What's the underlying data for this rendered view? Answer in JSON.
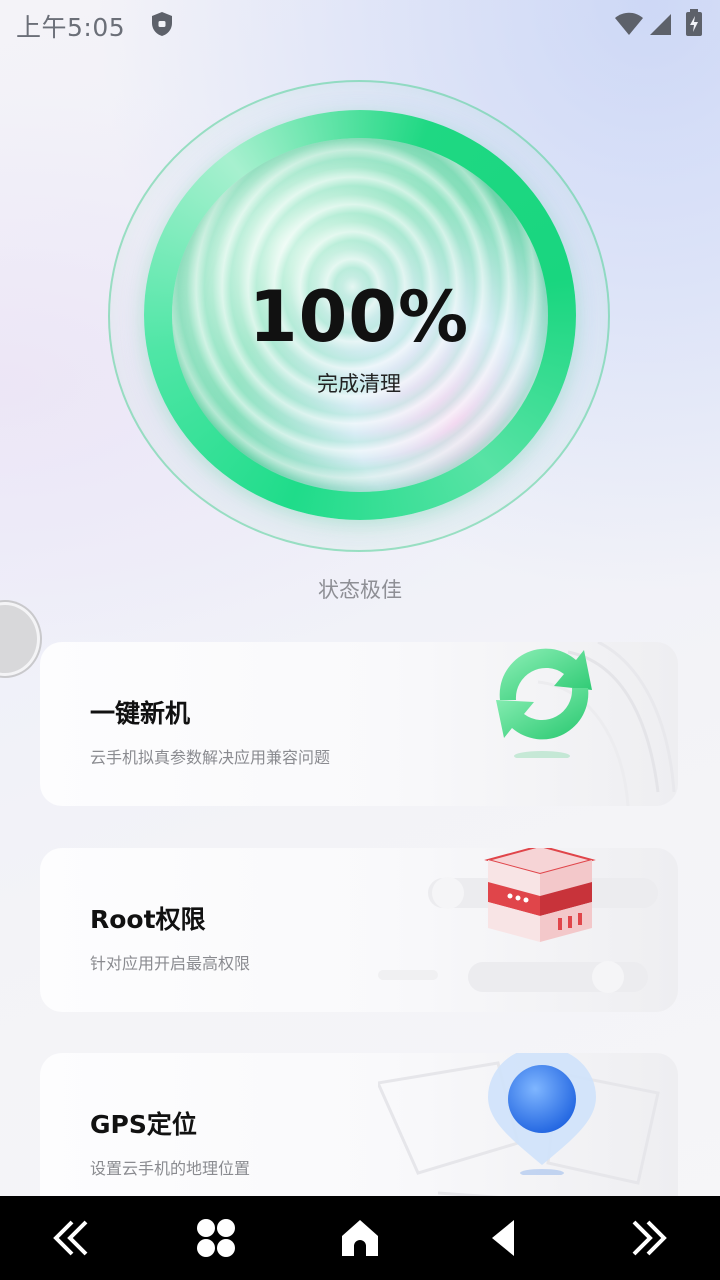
{
  "status_bar": {
    "time": "上午5:05",
    "icons": [
      "shield-icon",
      "wifi-icon",
      "signal-icon",
      "battery-charging-icon"
    ]
  },
  "hero": {
    "percent": "100%",
    "label": "完成清理",
    "progress_fraction": 1.0
  },
  "status_text": "状态极佳",
  "cards": [
    {
      "title": "一键新机",
      "subtitle": "云手机拟真参数解决应用兼容问题",
      "icon": "refresh-arrows-icon"
    },
    {
      "title": "Root权限",
      "subtitle": "针对应用开启最高权限",
      "icon": "server-rack-icon"
    },
    {
      "title": "GPS定位",
      "subtitle": "设置云手机的地理位置",
      "icon": "location-pin-icon"
    }
  ],
  "nav": {
    "buttons": [
      "double-chevron-left-icon",
      "apps-grid-icon",
      "home-icon",
      "back-triangle-icon",
      "double-chevron-right-icon"
    ]
  },
  "colors": {
    "accent_green": "#1fdc8a",
    "root_red": "#e0454a",
    "gps_blue": "#2f7ff0"
  }
}
